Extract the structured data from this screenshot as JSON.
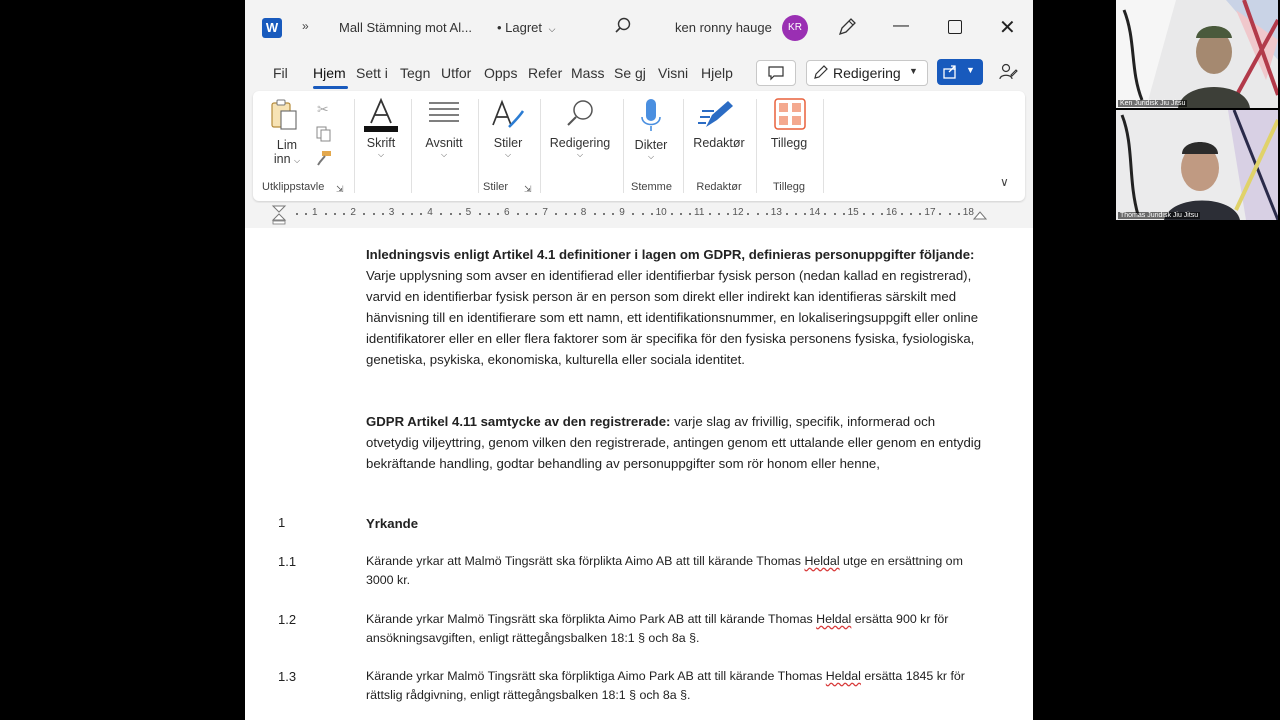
{
  "titlebar": {
    "doc_title": "Mall Stämning  mot Al...",
    "save_state": "• Lagret",
    "user_name": "ken ronny hauge",
    "user_initials": "KR"
  },
  "tabs": [
    "Fil",
    "Hjem",
    "Sett i",
    "Tegn",
    "Utfor",
    "Opps",
    "Refer",
    "Mass",
    "Se gj",
    "Visni",
    "Hjelp"
  ],
  "editing_button": "Redigering",
  "ribbon": {
    "clipboard": {
      "paste_label": "Lim",
      "paste_label2": "inn",
      "group": "Utklippstavle"
    },
    "font": {
      "label": "Skrift"
    },
    "paragraph": {
      "label": "Avsnitt"
    },
    "styles": {
      "label": "Stiler",
      "group": "Stiler"
    },
    "editing": {
      "label": "Redigering"
    },
    "voice": {
      "label": "Dikter",
      "group": "Stemme"
    },
    "editor": {
      "label": "Redaktør",
      "group": "Redaktør"
    },
    "addins": {
      "label": "Tillegg",
      "group": "Tillegg"
    }
  },
  "ruler": [
    "1",
    "2",
    "3",
    "4",
    "5",
    "6",
    "7",
    "8",
    "9",
    "10",
    "11",
    "12",
    "13",
    "14",
    "15",
    "16",
    "17",
    "18"
  ],
  "document": {
    "p1_bold": "Inledningsvis enligt Artikel 4.1 definitioner i lagen om GDPR, definieras personuppgifter följande:",
    "p1_text": " Varje upplysning som avser en identifierad eller identifierbar fysisk person (nedan kallad en registrerad), varvid en identifierbar fysisk person är en person som direkt eller indirekt kan identifieras särskilt med hänvisning till en identifierare som ett namn, ett identifikationsnummer, en lokaliseringsuppgift eller online identifikatorer eller en eller flera faktorer som är specifika för den fysiska personens fysiska, fysiologiska, genetiska, psykiska, ekonomiska, kulturella eller sociala identitet.",
    "p2_bold": "GDPR Artikel 4.11 samtycke av den registrerade:",
    "p2_text": " varje slag av frivillig, specifik, informerad och otvetydig viljeyttring, genom vilken den registrerade, antingen genom ett uttalande eller genom en entydig bekräftande handling, godtar behandling av personuppgifter som rör honom eller henne,",
    "section_num": "1",
    "section_title": "Yrkande",
    "claims": [
      {
        "num": "1.1",
        "pre": "Kärande yrkar att Malmö Tingsrätt ska förplikta Aimo AB att till kärande Thomas ",
        "name": "Heldal",
        "post": " utge en ersättning om 3000 kr."
      },
      {
        "num": "1.2",
        "pre": "Kärande yrkar Malmö Tingsrätt ska förplikta Aimo Park AB att till kärande Thomas ",
        "name": "Heldal",
        "post": " ersätta 900 kr för ansökningsavgiften, enligt rättegångsbalken 18:1 § och 8a §."
      },
      {
        "num": "1.3",
        "pre": "Kärande yrkar Malmö Tingsrätt ska förpliktiga Aimo Park AB att till kärande Thomas ",
        "name": "Heldal",
        "post": " ersätta 1845 kr för rättslig rådgivning, enligt rättegångsbalken 18:1 § och 8a §."
      }
    ]
  },
  "video": [
    {
      "name": "Ken Juridisk Jiu Jitsu"
    },
    {
      "name": "Thomas Juridisk Jiu Jitsu"
    }
  ],
  "colors": {
    "accent": "#185abd",
    "avatar": "#9a2fb3",
    "addins": "#e8603c"
  }
}
